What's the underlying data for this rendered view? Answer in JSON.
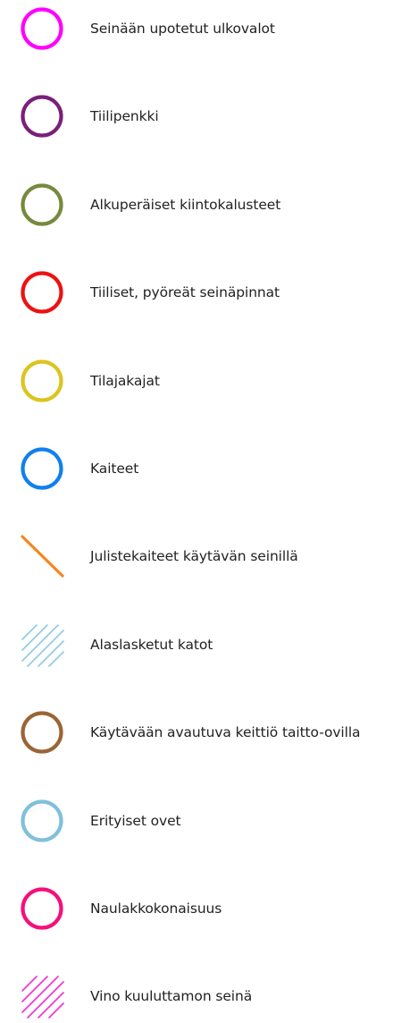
{
  "legend": {
    "items": [
      {
        "label": "Seinään upotetut ulkovalot",
        "symbol": "circle",
        "color": "#ff00ff",
        "icon": "circle-icon"
      },
      {
        "label": "Tiilipenkki",
        "symbol": "circle",
        "color": "#7a1f7a",
        "icon": "circle-icon"
      },
      {
        "label": "Alkuperäiset kiintokalusteet",
        "symbol": "circle",
        "color": "#768a3e",
        "icon": "circle-icon"
      },
      {
        "label": "Tiiliset, pyöreät seinäpinnat",
        "symbol": "circle",
        "color": "#ee1111",
        "icon": "circle-icon"
      },
      {
        "label": "Tilajakajat",
        "symbol": "circle",
        "color": "#dcc41e",
        "icon": "circle-icon"
      },
      {
        "label": "Kaiteet",
        "symbol": "circle",
        "color": "#1180ee",
        "icon": "circle-icon"
      },
      {
        "label": "Julistekaiteet käytävän seinillä",
        "symbol": "line",
        "color": "#f5861f",
        "icon": "diagonal-line-icon"
      },
      {
        "label": "Alaslasketut katot",
        "symbol": "hatch",
        "color": "#8fcbe0",
        "icon": "hatch-icon"
      },
      {
        "label": "Käytävään avautuva keittiö taitto-ovilla",
        "symbol": "circle",
        "color": "#9a6535",
        "icon": "circle-icon"
      },
      {
        "label": "Erityiset ovet",
        "symbol": "circle",
        "color": "#80c0dd",
        "icon": "circle-icon"
      },
      {
        "label": "Naulakkokonaisuus",
        "symbol": "circle",
        "color": "#f5107a",
        "icon": "circle-icon"
      },
      {
        "label": "Vino kuuluttamon seinä",
        "symbol": "hatch",
        "color": "#ef2fd8",
        "icon": "hatch-icon"
      }
    ]
  }
}
